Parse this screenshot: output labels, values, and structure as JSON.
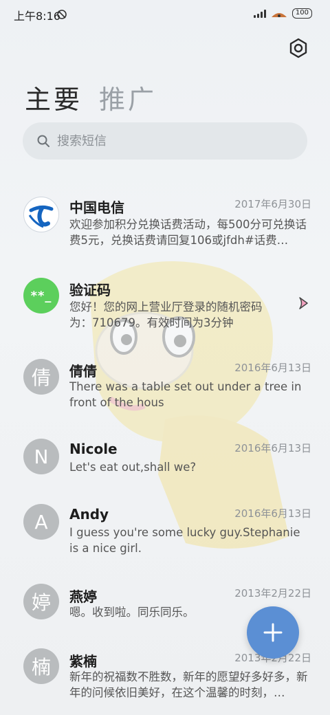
{
  "status": {
    "time": "上午8:16",
    "battery": "100"
  },
  "tabs": [
    {
      "label": "主要"
    },
    {
      "label": "推广"
    }
  ],
  "search": {
    "placeholder": "搜索短信"
  },
  "conversations": [
    {
      "name": "中国电信",
      "date": "2017年6月30日",
      "preview": "欢迎参加积分兑换话费活动，每500分可兑换话费5元，兑换话费请回复106或jfdh#话费…",
      "avatar": "telecom-logo"
    },
    {
      "name": "验证码",
      "date": "",
      "preview": "您好！您的网上营业厅登录的随机密码为：710679。有效时间为3分钟",
      "avatar_text": "**_"
    },
    {
      "name": "倩倩",
      "date": "2016年6月13日",
      "preview": "There was a table set out under a tree in front of the hous",
      "avatar_text": "倩"
    },
    {
      "name": "Nicole",
      "date": "2016年6月13日",
      "preview": "Let's eat out,shall we?",
      "avatar_text": "N"
    },
    {
      "name": "Andy",
      "date": "2016年6月13日",
      "preview": "I guess you're some lucky guy.Stephanie is a nice girl.",
      "avatar_text": "A"
    },
    {
      "name": "燕婷",
      "date": "2013年2月22日",
      "preview": "嗯。收到啦。同乐同乐。",
      "avatar_text": "婷"
    },
    {
      "name": "紫楠",
      "date": "2013年2月22日",
      "preview": "新年的祝福数不胜数，新年的愿望好多好多，新年的问候依旧美好，在这个温馨的时刻，…",
      "avatar_text": "楠"
    }
  ],
  "colors": {
    "fab": "#5b8fd4",
    "code_avatar": "#5ccf5c",
    "telecom_blue": "#1565c0"
  }
}
